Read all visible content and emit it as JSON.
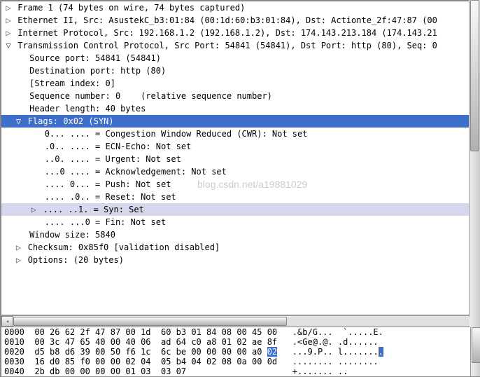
{
  "details": {
    "frame": {
      "arrow": "▷",
      "text": "Frame 1 (74 bytes on wire, 74 bytes captured)"
    },
    "eth": {
      "arrow": "▷",
      "text": "Ethernet II, Src: AsustekC_b3:01:84 (00:1d:60:b3:01:84), Dst: Actionte_2f:47:87 (00"
    },
    "ip": {
      "arrow": "▷",
      "text": "Internet Protocol, Src: 192.168.1.2 (192.168.1.2), Dst: 174.143.213.184 (174.143.21"
    },
    "tcp": {
      "arrow": "▽",
      "text": "Transmission Control Protocol, Src Port: 54841 (54841), Dst Port: http (80), Seq: 0"
    },
    "tcp_children": {
      "srcport": "Source port: 54841 (54841)",
      "dstport": "Destination port: http (80)",
      "stream": "[Stream index: 0]",
      "seq": "Sequence number: 0    (relative sequence number)",
      "hdrlen": "Header length: 40 bytes",
      "flags": {
        "arrow": "▽",
        "text": "Flags: 0x02 (SYN)"
      },
      "flag_children": {
        "cwr": "0... .... = Congestion Window Reduced (CWR): Not set",
        "ecn": ".0.. .... = ECN-Echo: Not set",
        "urg": "..0. .... = Urgent: Not set",
        "ack": "...0 .... = Acknowledgement: Not set",
        "psh": ".... 0... = Push: Not set",
        "rst": ".... .0.. = Reset: Not set",
        "syn": {
          "arrow": "▷",
          "text": ".... ..1. = Syn: Set"
        },
        "fin": ".... ...0 = Fin: Not set"
      },
      "win": "Window size: 5840",
      "chk": {
        "arrow": "▷",
        "text": "Checksum: 0x85f0 [validation disabled]"
      },
      "opt": {
        "arrow": "▷",
        "text": "Options: (20 bytes)"
      }
    }
  },
  "watermark": "blog.csdn.net/a19881029",
  "hex": {
    "r0": {
      "off": "0000",
      "b": "00 26 62 2f 47 87 00 1d  60 b3 01 84 08 00 45 00",
      "a": ".&b/G...  `.....E."
    },
    "r1": {
      "off": "0010",
      "b": "00 3c 47 65 40 00 40 06  ad 64 c0 a8 01 02 ae 8f",
      "a": ".<Ge@.@. .d......"
    },
    "r2": {
      "off": "0020",
      "b1": "d5 b8 d6 39 00 50 f6 1c  6c be 00 00 00 00 a0 ",
      "hl": "02",
      "a1": "...9.P.. l.......",
      "ahl": "."
    },
    "r3": {
      "off": "0030",
      "b": "16 d0 85 f0 00 00 02 04  05 b4 04 02 08 0a 00 0d",
      "a": "........ ........"
    },
    "r4": {
      "off": "0040",
      "b": "2b db 00 00 00 00 01 03  03 07",
      "a": "+....... .."
    }
  }
}
